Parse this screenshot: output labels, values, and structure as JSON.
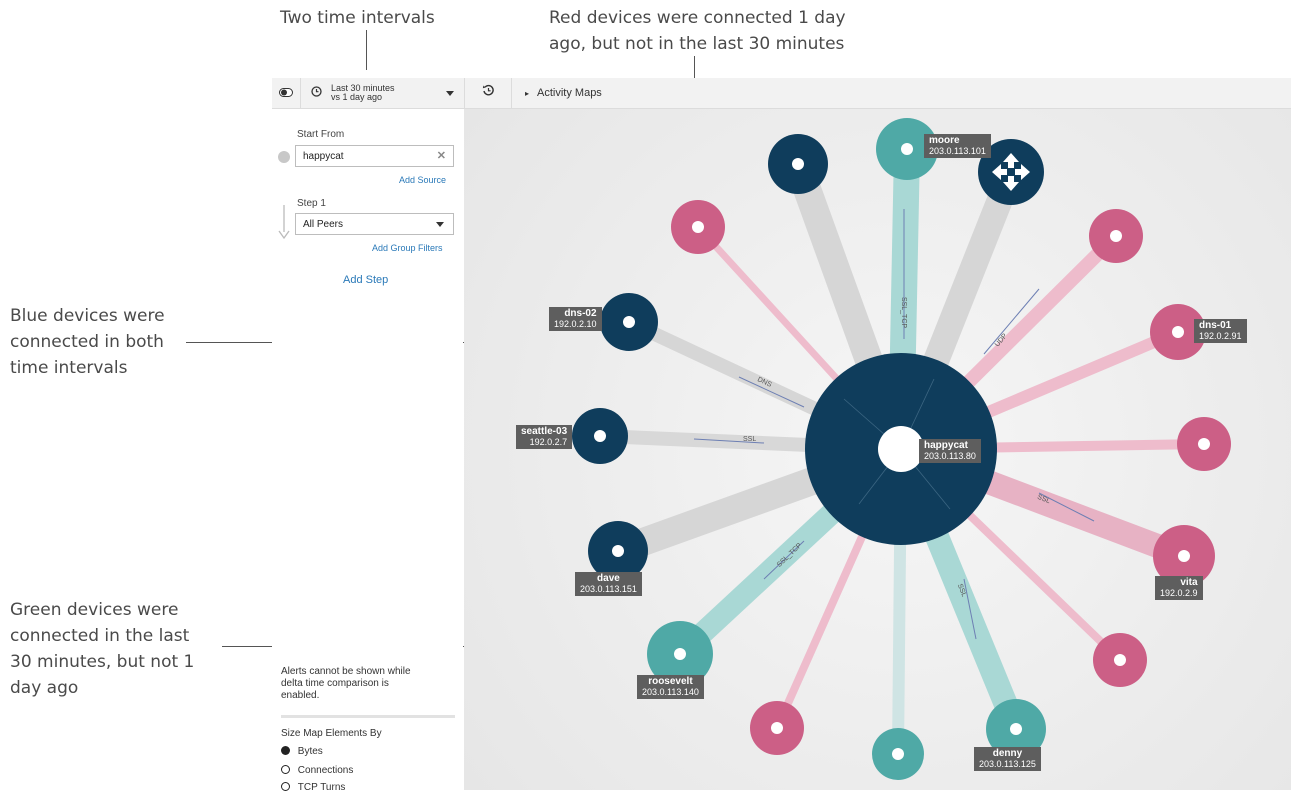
{
  "annotations": {
    "time_intervals": "Two time intervals",
    "red_line1": "Red devices were connected 1 day",
    "red_line2": "ago, but not in the last 30 minutes",
    "blue_line1": "Blue devices were",
    "blue_line2": "connected in both",
    "blue_line3": "time intervals",
    "green_line1": "Green devices were",
    "green_line2": "connected in the last",
    "green_line3": "30 minutes, but not 1",
    "green_line4": "day ago"
  },
  "toolbar": {
    "interval_line1": "Last 30 minutes",
    "interval_line2": "vs 1 day ago",
    "breadcrumb": "Activity Maps"
  },
  "sidebar": {
    "start_from_label": "Start From",
    "source_value": "happycat",
    "add_source": "Add Source",
    "step_label": "Step 1",
    "step_value": "All Peers",
    "add_group_filters": "Add Group Filters",
    "add_step": "Add Step",
    "alert_text_1": "Alerts cannot be shown while",
    "alert_text_2": "delta time comparison is",
    "alert_text_3": "enabled.",
    "size_by_label": "Size Map Elements By",
    "size_options": [
      "Bytes",
      "Connections",
      "TCP Turns"
    ],
    "size_selected": "Bytes"
  },
  "map": {
    "center": {
      "name": "happycat",
      "ip": "203.0.113.80"
    },
    "labels": {
      "moore": {
        "name": "moore",
        "ip": "203.0.113.101"
      },
      "dns02": {
        "name": "dns-02",
        "ip": "192.0.2.10"
      },
      "seattle03": {
        "name": "seattle-03",
        "ip": "192.0.2.7"
      },
      "dave": {
        "name": "dave",
        "ip": "203.0.113.151"
      },
      "roosevelt": {
        "name": "roosevelt",
        "ip": "203.0.113.140"
      },
      "denny": {
        "name": "denny",
        "ip": "203.0.113.125"
      },
      "vita": {
        "name": "vita",
        "ip": "192.0.2.9"
      },
      "dns01": {
        "name": "dns-01",
        "ip": "192.0.2.91"
      }
    },
    "protocols": {
      "ssl_tcp_top": "SSL_TCP",
      "udp": "UDP",
      "dns": "DNS",
      "ssl_left": "SSL",
      "ssl_right": "SSL",
      "ssl_tcp_bottom": "SSL_TCP",
      "ssl_bottom": "SSL"
    },
    "colors": {
      "blue": "#0f3d5c",
      "red": "#cc5f86",
      "green": "#4fa9a6"
    }
  }
}
